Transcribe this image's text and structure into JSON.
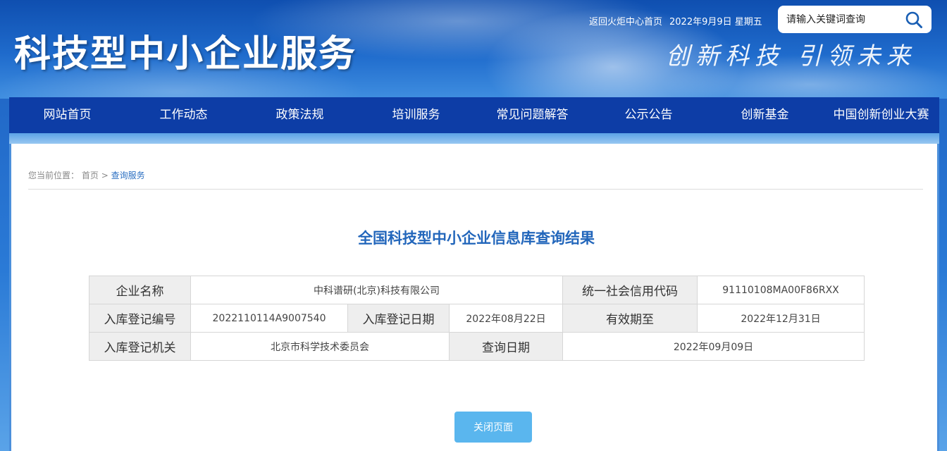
{
  "header": {
    "site_title": "科技型中小企业服务",
    "slogan": "创新科技 引领未来",
    "home_link": "返回火炬中心首页",
    "date": "2022年9月9日 星期五",
    "search_placeholder": "请输入关键词查询"
  },
  "nav": {
    "items": [
      "网站首页",
      "工作动态",
      "政策法规",
      "培训服务",
      "常见问题解答",
      "公示公告",
      "创新基金",
      "中国创新创业大赛"
    ]
  },
  "breadcrumb": {
    "prefix": "您当前位置：",
    "home": "首页",
    "separator": ">",
    "current": "查询服务"
  },
  "result": {
    "title": "全国科技型中小企业信息库查询结果",
    "labels": {
      "company_name": "企业名称",
      "credit_code": "统一社会信用代码",
      "reg_number": "入库登记编号",
      "reg_date": "入库登记日期",
      "valid_until": "有效期至",
      "reg_authority": "入库登记机关",
      "query_date": "查询日期"
    },
    "values": {
      "company_name": "中科谱研(北京)科技有限公司",
      "credit_code": "91110108MA00F86RXX",
      "reg_number": "2022110114A9007540",
      "reg_date": "2022年08月22日",
      "valid_until": "2022年12月31日",
      "reg_authority": "北京市科学技术委员会",
      "query_date": "2022年09月09日"
    }
  },
  "actions": {
    "close_label": "关闭页面"
  },
  "colors": {
    "nav_bg": "#0d3da6",
    "title_blue": "#2266bb",
    "button_bg": "#5ab6ee"
  }
}
